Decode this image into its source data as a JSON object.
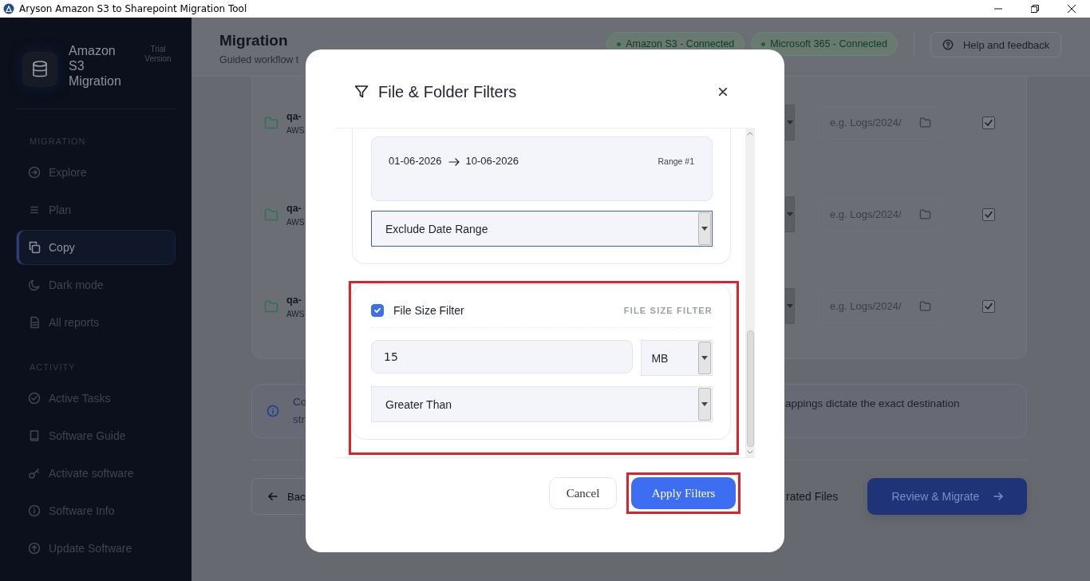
{
  "title_bar": {
    "title": "Aryson Amazon S3 to Sharepoint Migration Tool"
  },
  "sidebar": {
    "app_name": "Amazon S3 Migration",
    "badge": "Trial Version",
    "sections": [
      {
        "heading": "MIGRATION",
        "items": [
          {
            "label": "Explore",
            "selected": false
          },
          {
            "label": "Plan",
            "selected": false
          },
          {
            "label": "Copy",
            "selected": true
          },
          {
            "label": "Dark mode",
            "selected": false
          },
          {
            "label": "All reports",
            "selected": false
          }
        ]
      },
      {
        "heading": "ACTIVITY",
        "items": [
          {
            "label": "Active Tasks",
            "selected": false
          },
          {
            "label": "Software Guide",
            "selected": false
          },
          {
            "label": "Activate software",
            "selected": false
          },
          {
            "label": "Software Info",
            "selected": false
          },
          {
            "label": "Update Software",
            "selected": false
          }
        ]
      }
    ]
  },
  "header": {
    "title": "Migration",
    "subtitle": "Guided workflow t",
    "connections": [
      {
        "label": "Amazon S3 - Connected"
      },
      {
        "label": "Microsoft 365 - Connected"
      }
    ],
    "help": "Help and feedback"
  },
  "buckets": [
    {
      "name": "qa-",
      "source": "AWS",
      "path_placeholder": "e.g. Logs/2024/",
      "checked": true
    },
    {
      "name": "qa-",
      "source": "AWS",
      "path_placeholder": "e.g. Logs/2024/",
      "checked": true
    },
    {
      "name": "qa-",
      "source": "AWS",
      "path_placeholder": "e.g. Logs/2024/",
      "checked": true
    }
  ],
  "notice": {
    "left_lines": [
      "Co",
      "str"
    ],
    "right_text": "appings dictate the exact destination"
  },
  "footer": {
    "back": "Bac",
    "files_link": "rated Files",
    "primary": "Review & Migrate"
  },
  "dialog": {
    "title": "File & Folder Filters",
    "date_range": {
      "start": "01-06-2026",
      "end": "10-06-2026",
      "label": "Range #1",
      "mode": "Exclude Date Range"
    },
    "file_size": {
      "highlighted": true,
      "enabled": true,
      "label": "File Size Filter",
      "tag": "FILE SIZE FILTER",
      "value": "15",
      "unit": "MB",
      "comparison": "Greater Than"
    },
    "buttons": [
      {
        "label": "Cancel",
        "kind": "secondary",
        "highlighted": false
      },
      {
        "label": "Apply Filters",
        "kind": "primary",
        "highlighted": true
      }
    ]
  }
}
